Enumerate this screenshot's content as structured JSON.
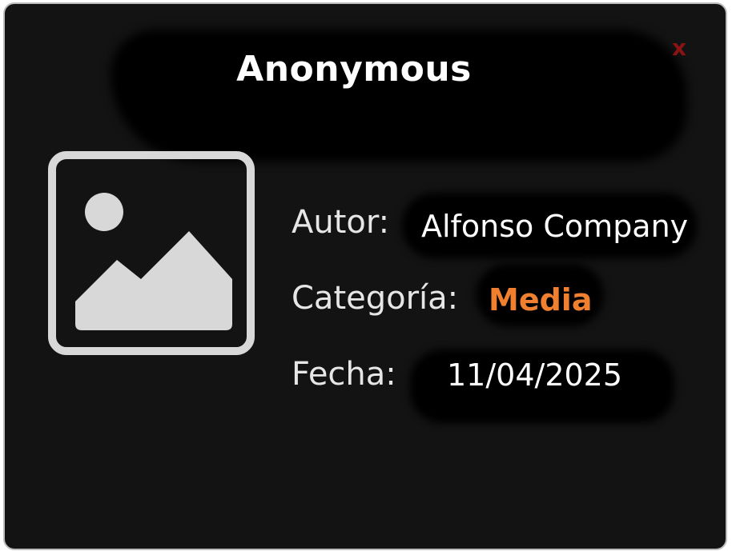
{
  "dialog": {
    "title": "Anonymous",
    "close_label": "x"
  },
  "icon": "image-placeholder-icon",
  "fields": {
    "author": {
      "label": "Autor:",
      "value": "Alfonso Company"
    },
    "category": {
      "label": "Categoría:",
      "value": "Media"
    },
    "date": {
      "label": "Fecha:",
      "value": "11/04/2025"
    }
  },
  "colors": {
    "background": "#131313",
    "title": "#ffffff",
    "close": "#8a1414",
    "label": "#e6e6e6",
    "category_accent": "#f08030",
    "icon": "#d8d8d8"
  }
}
